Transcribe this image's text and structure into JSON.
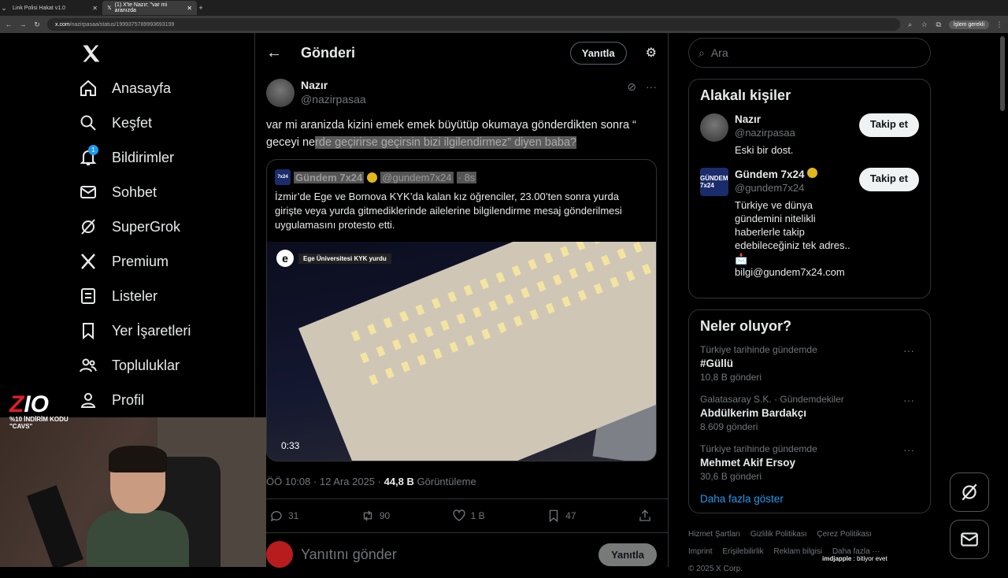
{
  "browser": {
    "tabs": [
      {
        "label": "Link Polisi Hakat v1.0"
      },
      {
        "label": "(1) X'te Nazır: \"var mi aranızda"
      }
    ],
    "url_domain": "x.com",
    "url_path": "/nazirpasaa/status/1999375789993693199",
    "profile_button": "İşlem gerekli"
  },
  "nav": {
    "items": [
      {
        "label": "Anasayfa",
        "icon": "home-icon"
      },
      {
        "label": "Keşfet",
        "icon": "search-icon"
      },
      {
        "label": "Bildirimler",
        "icon": "bell-icon",
        "badge": "1"
      },
      {
        "label": "Sohbet",
        "icon": "mail-icon"
      },
      {
        "label": "SuperGrok",
        "icon": "grok-icon"
      },
      {
        "label": "Premium",
        "icon": "x-logo-icon"
      },
      {
        "label": "Listeler",
        "icon": "list-icon"
      },
      {
        "label": "Yer İşaretleri",
        "icon": "bookmark-icon"
      },
      {
        "label": "Topluluklar",
        "icon": "people-icon"
      },
      {
        "label": "Profil",
        "icon": "person-icon"
      }
    ]
  },
  "header": {
    "title": "Gönderi",
    "reply_button": "Yanıtla"
  },
  "tweet": {
    "name": "Nazır",
    "handle": "@nazirpasaa",
    "text_plain": "var mi aranizda kizini emek emek büyütüp okumaya gönderdikten sonra “ geceyi ne",
    "text_highlight": "rde geçirirse geçirsin bizi ilgilendirmez” diyen baba?",
    "quote": {
      "avatar_text": "7x24",
      "name": "Gündem 7x24",
      "handle": "@gundem7x24",
      "time": "· 8s",
      "text": "İzmir’de Ege ve Bornova KYK’da kalan kız öğrenciler, 23.00’ten sonra yurda girişte veya yurda gitmediklerinde ailelerine bilgilendirme mesaj gönderilmesi uygulamasını protesto etti.",
      "video_label": "Ege Üniversitesi KYK yurdu",
      "video_logo": "e",
      "video_time": "0:33"
    },
    "meta_time": "ÖÖ 10:08 · 12 Ara 2025 · ",
    "meta_views": "44,8 B",
    "meta_views_label": " Görüntüleme",
    "metrics": {
      "replies": "31",
      "reposts": "90",
      "likes": "1 B",
      "bookmarks": "47"
    },
    "reply_placeholder": "Yanıtını gönder",
    "reply_button": "Yanıtla"
  },
  "sidebar": {
    "search_placeholder": "Ara",
    "related_title": "Alakalı kişiler",
    "people": [
      {
        "name": "Nazır",
        "handle": "@nazirpasaa",
        "bio": "Eski bir dost.",
        "button": "Takip et"
      },
      {
        "name": "Gündem 7x24",
        "handle": "@gundem7x24",
        "bio": "Türkiye ve dünya gündemini nitelikli haberlerle takip edebileceğiniz tek adres.. 📩bilgi@gundem7x24.com",
        "button": "Takip et",
        "avatar_text": "GÜNDEM 7x24"
      }
    ],
    "trends_title": "Neler oluyor?",
    "trends": [
      {
        "category": "Türkiye tarihinde gündemde",
        "title": "#Güllü",
        "count": "10,8 B gönderi"
      },
      {
        "category": "Galatasaray S.K. · Gündemdekiler",
        "title": "Abdülkerim Bardakçı",
        "count": "8.609 gönderi"
      },
      {
        "category": "Türkiye tarihinde gündemde",
        "title": "Mehmet Akif Ersoy",
        "count": "30,6 B gönderi"
      }
    ],
    "more_link": "Daha fazla göster",
    "footer": [
      "Hizmet Şartları",
      "Gizlilik Politikası",
      "Çerez Politikası",
      "Imprint",
      "Erişilebilirlik",
      "Reklam bilgisi",
      "Daha fazla ···",
      "© 2025 X Corp."
    ]
  },
  "overlay": {
    "promo_logo_z": "Z",
    "promo_logo_rest": "IO",
    "promo_text": "%10 İNDİRİM KODU \"CAVS\"",
    "chat_user": "imdjapple",
    "chat_msg": " : bitiyor evet"
  },
  "colors": {
    "accent": "#1d9bf0",
    "background": "#000000",
    "border": "#2f3336",
    "muted": "#71767b"
  }
}
